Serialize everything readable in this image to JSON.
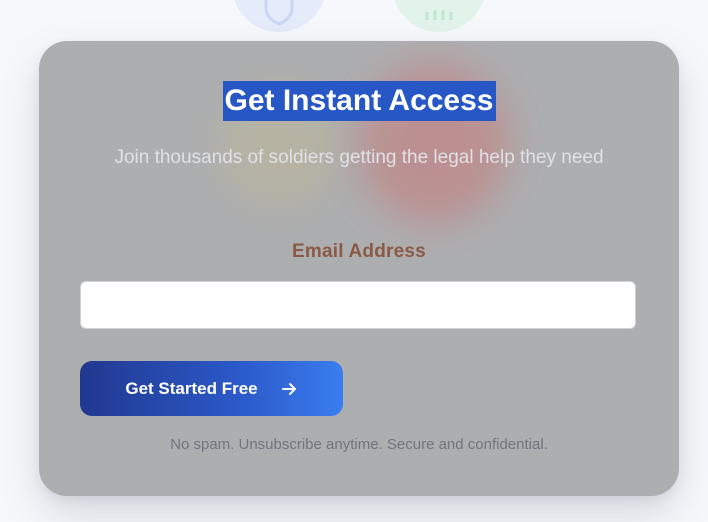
{
  "background_icons": [
    {
      "name": "shield-icon",
      "color": "#e4ebfb"
    },
    {
      "name": "people-icon",
      "color": "#e2f4ea"
    }
  ],
  "card": {
    "title": "Get Instant Access",
    "subtitle": "Join thousands of soldiers getting the legal help they need",
    "email_label": "Email Address",
    "email_value": "",
    "email_placeholder": "",
    "cta_label": "Get Started Free",
    "cta_icon": "arrow-right-icon",
    "note": "No spam. Unsubscribe anytime. Secure and confidential."
  },
  "colors": {
    "title_highlight": "#2756c5",
    "label": "#8a5a46",
    "cta_gradient_start": "#21388f",
    "cta_gradient_end": "#3a7df0"
  }
}
